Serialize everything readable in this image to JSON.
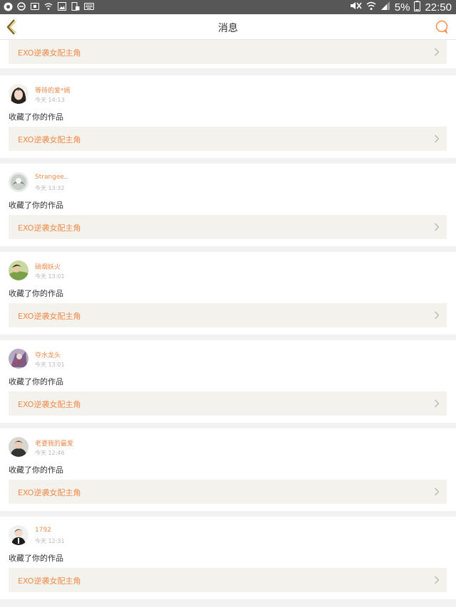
{
  "status_bar": {
    "battery": "5%",
    "time": "22:50"
  },
  "nav": {
    "title": "消息",
    "back_icon": "chevron-left-icon",
    "chat_icon": "chat-bubble-icon"
  },
  "top_partial_work": "EXO逆袭女配主角",
  "messages": [
    {
      "username": "等待的爱*嫣",
      "time": "今天 14:13",
      "action": "收藏了你的作品",
      "work": "EXO逆袭女配主角"
    },
    {
      "username": "Strangee..",
      "time": "今天 13:32",
      "action": "收藏了你的作品",
      "work": "EXO逆袭女配主角"
    },
    {
      "username": "硝烟妖火",
      "time": "今天 13:01",
      "action": "收藏了你的作品",
      "work": "EXO逆袭女配主角"
    },
    {
      "username": "夺水龙头",
      "time": "今天 13:01",
      "action": "收藏了你的作品",
      "work": "EXO逆袭女配主角"
    },
    {
      "username": "老婆我的最爱",
      "time": "今天 12:46",
      "action": "收藏了你的作品",
      "work": "EXO逆袭女配主角"
    },
    {
      "username": "1792",
      "time": "今天 12:31",
      "action": "收藏了你的作品",
      "work": "EXO逆袭女配主角"
    }
  ],
  "colors": {
    "accent": "#f08a4b",
    "row_bg": "#f3f2ec",
    "page_bg": "#f2f2f2"
  }
}
